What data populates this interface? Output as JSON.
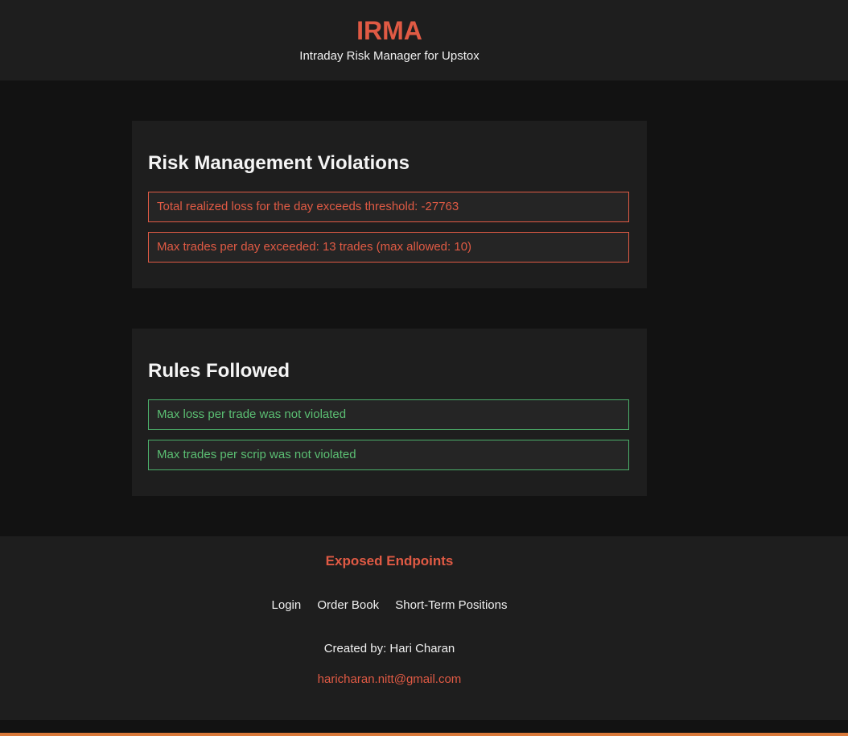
{
  "header": {
    "title": "IRMA",
    "subtitle": "Intraday Risk Manager for Upstox"
  },
  "violations": {
    "title": "Risk Management Violations",
    "items": [
      "Total realized loss for the day exceeds threshold: -27763",
      "Max trades per day exceeded: 13 trades (max allowed: 10)"
    ]
  },
  "rules": {
    "title": "Rules Followed",
    "items": [
      "Max loss per trade was not violated",
      "Max trades per scrip was not violated"
    ]
  },
  "footer": {
    "title": "Exposed Endpoints",
    "links": [
      "Login",
      "Order Book",
      "Short-Term Positions"
    ],
    "credit": "Created by: Hari Charan",
    "email": "haricharan.nitt@gmail.com"
  },
  "colors": {
    "accent": "#e05a44",
    "violation": "#e05a44",
    "success": "#5bbf73",
    "background": "#121212",
    "panel": "#1e1e1e"
  }
}
